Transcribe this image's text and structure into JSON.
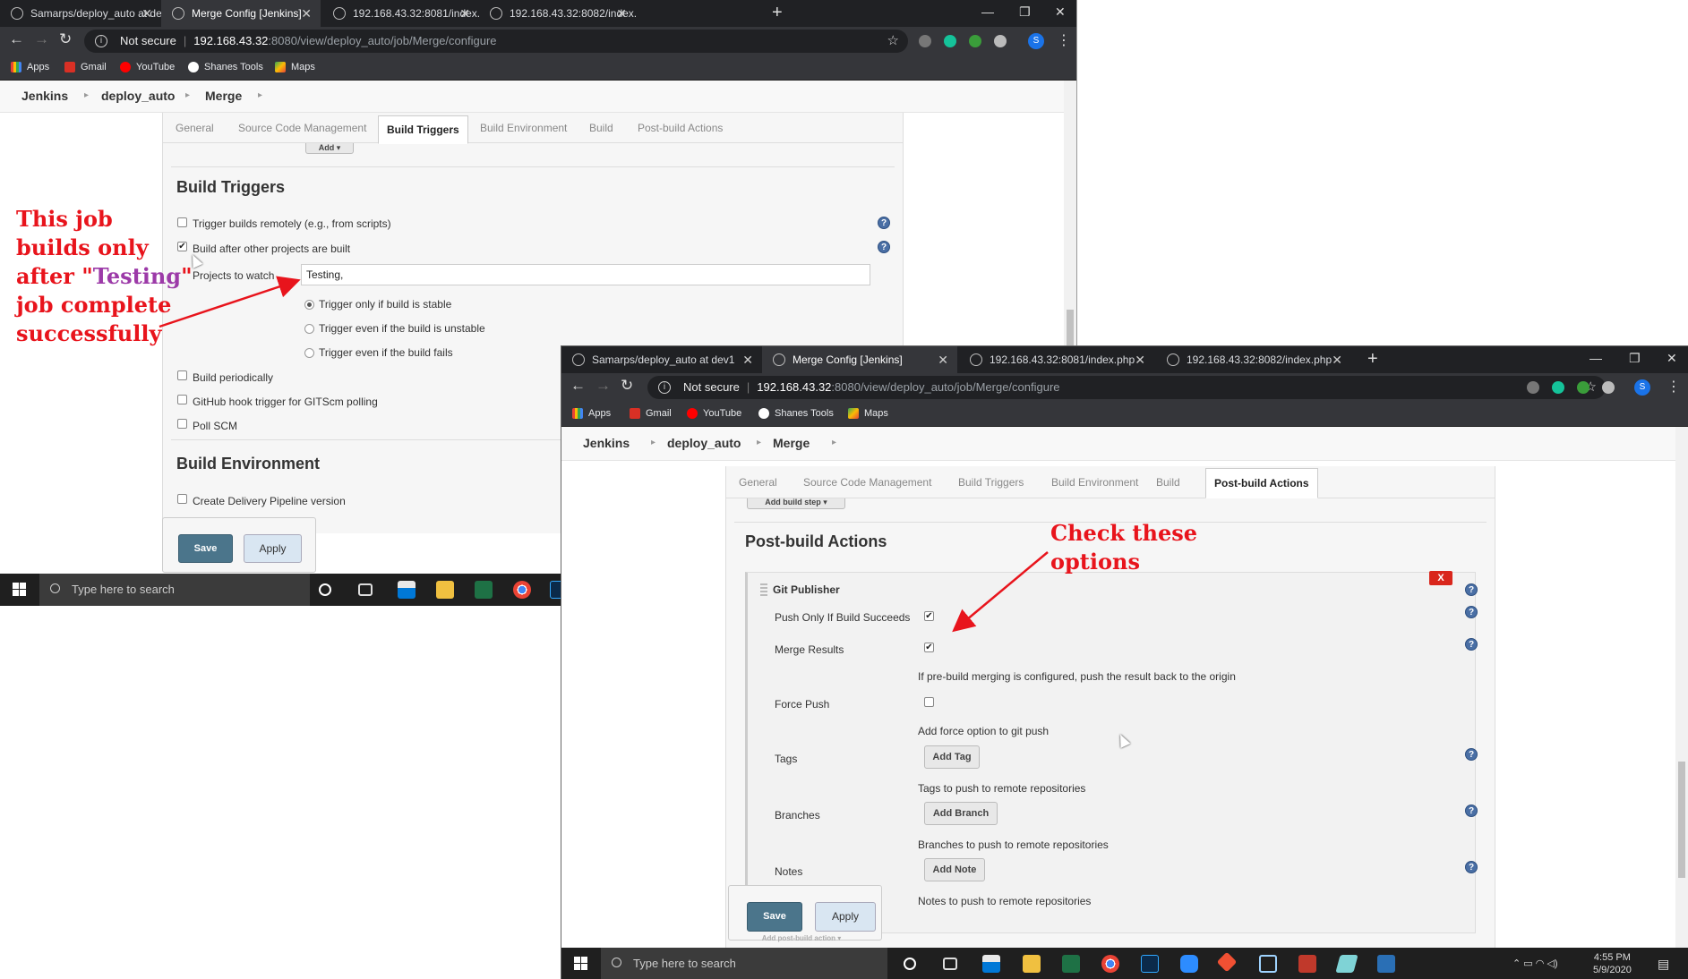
{
  "browser": {
    "tabs": [
      "Samarps/deploy_auto at dev1",
      "Merge Config [Jenkins]",
      "192.168.43.32:8081/index.php",
      "192.168.43.32:8082/index.php"
    ],
    "new_tab": "+",
    "not_secure": "Not secure",
    "url_host": "192.168.43.32",
    "url_path": ":8080/view/deploy_auto/job/Merge/configure",
    "profile_initial": "S",
    "bookmarks": [
      "Apps",
      "Gmail",
      "YouTube",
      "Shanes Tools",
      "Maps"
    ]
  },
  "breadcrumb": [
    "Jenkins",
    "deploy_auto",
    "Merge"
  ],
  "config_tabs": [
    "General",
    "Source Code Management",
    "Build Triggers",
    "Build Environment",
    "Build",
    "Post-build Actions"
  ],
  "window1": {
    "add_button": "Add",
    "build_triggers_title": "Build Triggers",
    "triggers": [
      {
        "label": "Trigger builds remotely (e.g., from scripts)",
        "checked": false
      },
      {
        "label": "Build after other projects are built",
        "checked": true
      }
    ],
    "projects_label": "Projects to watch",
    "projects_value": "Testing,",
    "radios": [
      {
        "label": "Trigger only if build is stable",
        "selected": true
      },
      {
        "label": "Trigger even if the build is unstable",
        "selected": false
      },
      {
        "label": "Trigger even if the build fails",
        "selected": false
      }
    ],
    "more_triggers": [
      {
        "label": "Build periodically",
        "checked": false
      },
      {
        "label": "GitHub hook trigger for GITScm polling",
        "checked": false
      },
      {
        "label": "Poll SCM",
        "checked": false
      }
    ],
    "build_env_title": "Build Environment",
    "env_options": [
      {
        "label": "Create Delivery Pipeline version",
        "checked": false
      }
    ],
    "save": "Save",
    "apply": "Apply"
  },
  "window2": {
    "add_build_step": "Add build step",
    "post_build_title": "Post-build Actions",
    "publisher_title": "Git Publisher",
    "delete_label": "X",
    "push_only": {
      "label": "Push Only If Build Succeeds",
      "checked": true
    },
    "merge_results": {
      "label": "Merge Results",
      "checked": true,
      "desc": "If pre-build merging is configured, push the result back to the origin"
    },
    "force_push": {
      "label": "Force Push",
      "checked": false,
      "desc": "Add force option to git push"
    },
    "tags": {
      "label": "Tags",
      "button": "Add Tag",
      "desc": "Tags to push to remote repositories"
    },
    "branches": {
      "label": "Branches",
      "button": "Add Branch",
      "desc": "Branches to push to remote repositories"
    },
    "notes": {
      "label": "Notes",
      "button": "Add Note",
      "desc": "Notes to push to remote repositories"
    },
    "add_post_build": "Add post-build action",
    "save": "Save",
    "apply": "Apply"
  },
  "annotations": {
    "job_note_lines": [
      "This job",
      "builds only",
      "after \"",
      "Testing",
      "\"",
      "job complete",
      "successfully"
    ],
    "check_note_lines": [
      "Check these",
      "options"
    ]
  },
  "taskbar": {
    "search_placeholder": "Type here to search",
    "time": "4:55 PM",
    "date": "5/9/2020"
  },
  "colors": {
    "annotation_red": "#e8141c",
    "annotation_purple": "#9c3aa8",
    "jenkins_save": "#4b758b",
    "chrome_dark": "#202124"
  }
}
